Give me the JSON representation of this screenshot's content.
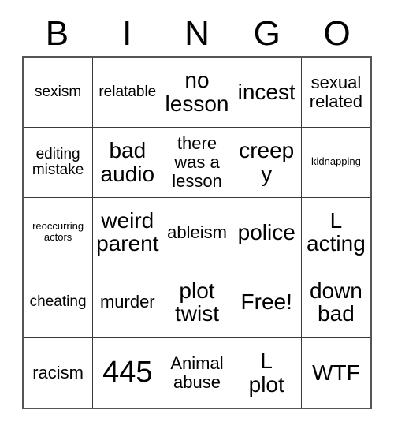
{
  "card": {
    "headers": [
      "B",
      "I",
      "N",
      "G",
      "O"
    ],
    "rows": [
      [
        {
          "text": "sexism",
          "size": "sm"
        },
        {
          "text": "relatable",
          "size": "sm"
        },
        {
          "text": "no\nlesson",
          "size": "lg"
        },
        {
          "text": "incest",
          "size": "lg"
        },
        {
          "text": "sexual\nrelated",
          "size": "md"
        }
      ],
      [
        {
          "text": "editing\nmistake",
          "size": "sm"
        },
        {
          "text": "bad\naudio",
          "size": "lg"
        },
        {
          "text": "there\nwas a\nlesson",
          "size": "md"
        },
        {
          "text": "creepy",
          "size": "lg"
        },
        {
          "text": "kidnapping",
          "size": "xs"
        }
      ],
      [
        {
          "text": "reoccurring\nactors",
          "size": "xs"
        },
        {
          "text": "weird\nparent",
          "size": "lg"
        },
        {
          "text": "ableism",
          "size": "md"
        },
        {
          "text": "police",
          "size": "lg"
        },
        {
          "text": "L\nacting",
          "size": "lg"
        }
      ],
      [
        {
          "text": "cheating",
          "size": "sm"
        },
        {
          "text": "murder",
          "size": "md"
        },
        {
          "text": "plot\ntwist",
          "size": "lg"
        },
        {
          "text": "Free!",
          "size": "lg"
        },
        {
          "text": "down\nbad",
          "size": "lg"
        }
      ],
      [
        {
          "text": "racism",
          "size": "md"
        },
        {
          "text": "445",
          "size": "xl"
        },
        {
          "text": "Animal\nabuse",
          "size": "md"
        },
        {
          "text": "L\nplot",
          "size": "lg"
        },
        {
          "text": "WTF",
          "size": "lg"
        }
      ]
    ]
  },
  "colors": {
    "text": "#000000",
    "grid_line": "#3a3a3a",
    "outer_border": "#555555",
    "background": "#ffffff"
  }
}
